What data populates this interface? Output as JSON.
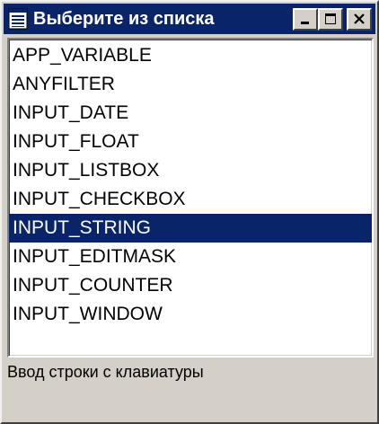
{
  "window": {
    "title": "Выберите из списка",
    "icon": "list-window-icon",
    "buttons": {
      "minimize_icon": "minimize-icon",
      "maximize_icon": "maximize-icon",
      "close_icon": "close-icon"
    }
  },
  "list": {
    "items": [
      "APP_VARIABLE",
      "ANYFILTER",
      "INPUT_DATE",
      "INPUT_FLOAT",
      "INPUT_LISTBOX",
      "INPUT_CHECKBOX",
      "INPUT_STRING",
      "INPUT_EDITMASK",
      "INPUT_COUNTER",
      "INPUT_WINDOW"
    ],
    "selected": "INPUT_STRING"
  },
  "status": {
    "description": "Ввод строки с клавиатуры"
  },
  "colors": {
    "titlebar": "#0a246a",
    "selection": "#0a246a",
    "face": "#d4d0c8"
  }
}
